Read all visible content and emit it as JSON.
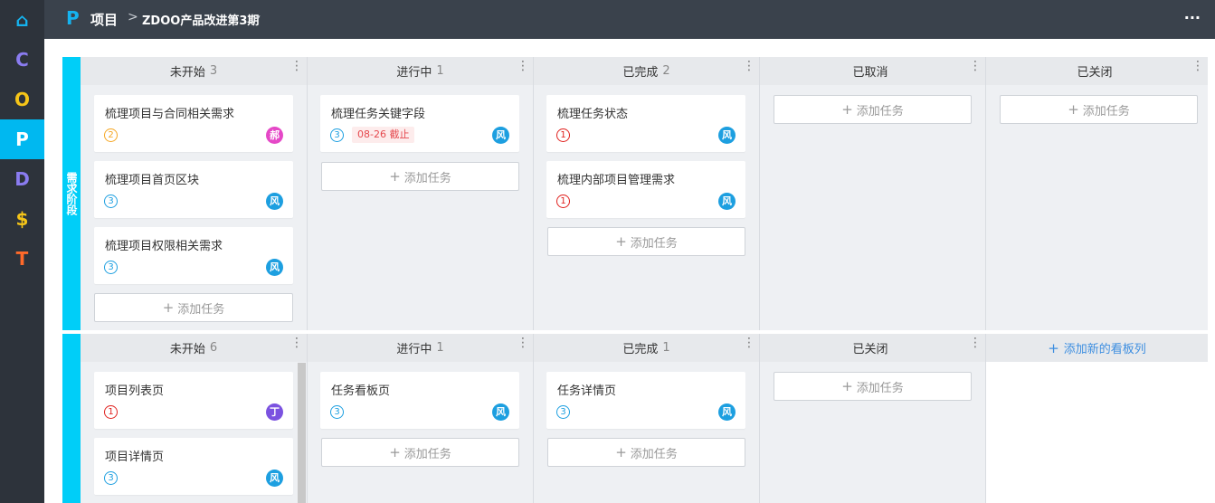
{
  "nav": {
    "items": [
      {
        "letter": "⌂",
        "color": "#15b3ef"
      },
      {
        "letter": "C",
        "color": "#8a7cf0"
      },
      {
        "letter": "O",
        "color": "#f5c518"
      },
      {
        "letter": "P",
        "color": "#ffffff"
      },
      {
        "letter": "D",
        "color": "#8a7cf0"
      },
      {
        "letter": "$",
        "color": "#f5c518"
      },
      {
        "letter": "T",
        "color": "#ff6a2a"
      }
    ]
  },
  "header": {
    "logo": "P",
    "module": "项目",
    "separator": ">",
    "project_title": "ZDOO产品改进第3期",
    "caret": "▾",
    "more": "···"
  },
  "add_task_label": "添加任务",
  "plus": "+",
  "lanes": [
    {
      "label": "需求阶段",
      "columns": [
        {
          "name": "未开始",
          "count": "3",
          "cards": [
            {
              "title": "梳理项目与合同相关需求",
              "pri": "2",
              "pri_color": "#f5a623",
              "avatar": "郝",
              "avatar_color": "#e548c7"
            },
            {
              "title": "梳理项目首页区块",
              "pri": "3",
              "pri_color": "#1d9fe0",
              "avatar": "风",
              "avatar_color": "#1d9fe0"
            },
            {
              "title": "梳理项目权限相关需求",
              "pri": "3",
              "pri_color": "#1d9fe0",
              "avatar": "风",
              "avatar_color": "#1d9fe0"
            }
          ]
        },
        {
          "name": "进行中",
          "count": "1",
          "cards": [
            {
              "title": "梳理任务关键字段",
              "pri": "3",
              "pri_color": "#1d9fe0",
              "due": "08-26 截止",
              "avatar": "风",
              "avatar_color": "#1d9fe0"
            }
          ]
        },
        {
          "name": "已完成",
          "count": "2",
          "cards": [
            {
              "title": "梳理任务状态",
              "pri": "1",
              "pri_color": "#e0201d",
              "avatar": "风",
              "avatar_color": "#1d9fe0"
            },
            {
              "title": "梳理内部项目管理需求",
              "pri": "1",
              "pri_color": "#e0201d",
              "avatar": "风",
              "avatar_color": "#1d9fe0"
            }
          ]
        },
        {
          "name": "已取消",
          "count": "",
          "cards": []
        },
        {
          "name": "已关闭",
          "count": "",
          "cards": []
        }
      ]
    },
    {
      "label": "",
      "columns": [
        {
          "name": "未开始",
          "count": "6",
          "cards": [
            {
              "title": "项目列表页",
              "pri": "1",
              "pri_color": "#e0201d",
              "avatar": "丁",
              "avatar_color": "#7b52e0"
            },
            {
              "title": "项目详情页",
              "pri": "3",
              "pri_color": "#1d9fe0",
              "avatar": "风",
              "avatar_color": "#1d9fe0"
            }
          ]
        },
        {
          "name": "进行中",
          "count": "1",
          "cards": [
            {
              "title": "任务看板页",
              "pri": "3",
              "pri_color": "#1d9fe0",
              "avatar": "风",
              "avatar_color": "#1d9fe0"
            }
          ]
        },
        {
          "name": "已完成",
          "count": "1",
          "cards": [
            {
              "title": "任务详情页",
              "pri": "3",
              "pri_color": "#1d9fe0",
              "avatar": "风",
              "avatar_color": "#1d9fe0"
            }
          ]
        },
        {
          "name": "已关闭",
          "count": "",
          "cards": []
        }
      ],
      "add_column_label": "添加新的看板列"
    }
  ],
  "colors": {
    "accent": "#00cef8",
    "link": "#3d8ee0",
    "nav_bg": "#2d333b",
    "topbar_bg": "#3a424c"
  }
}
